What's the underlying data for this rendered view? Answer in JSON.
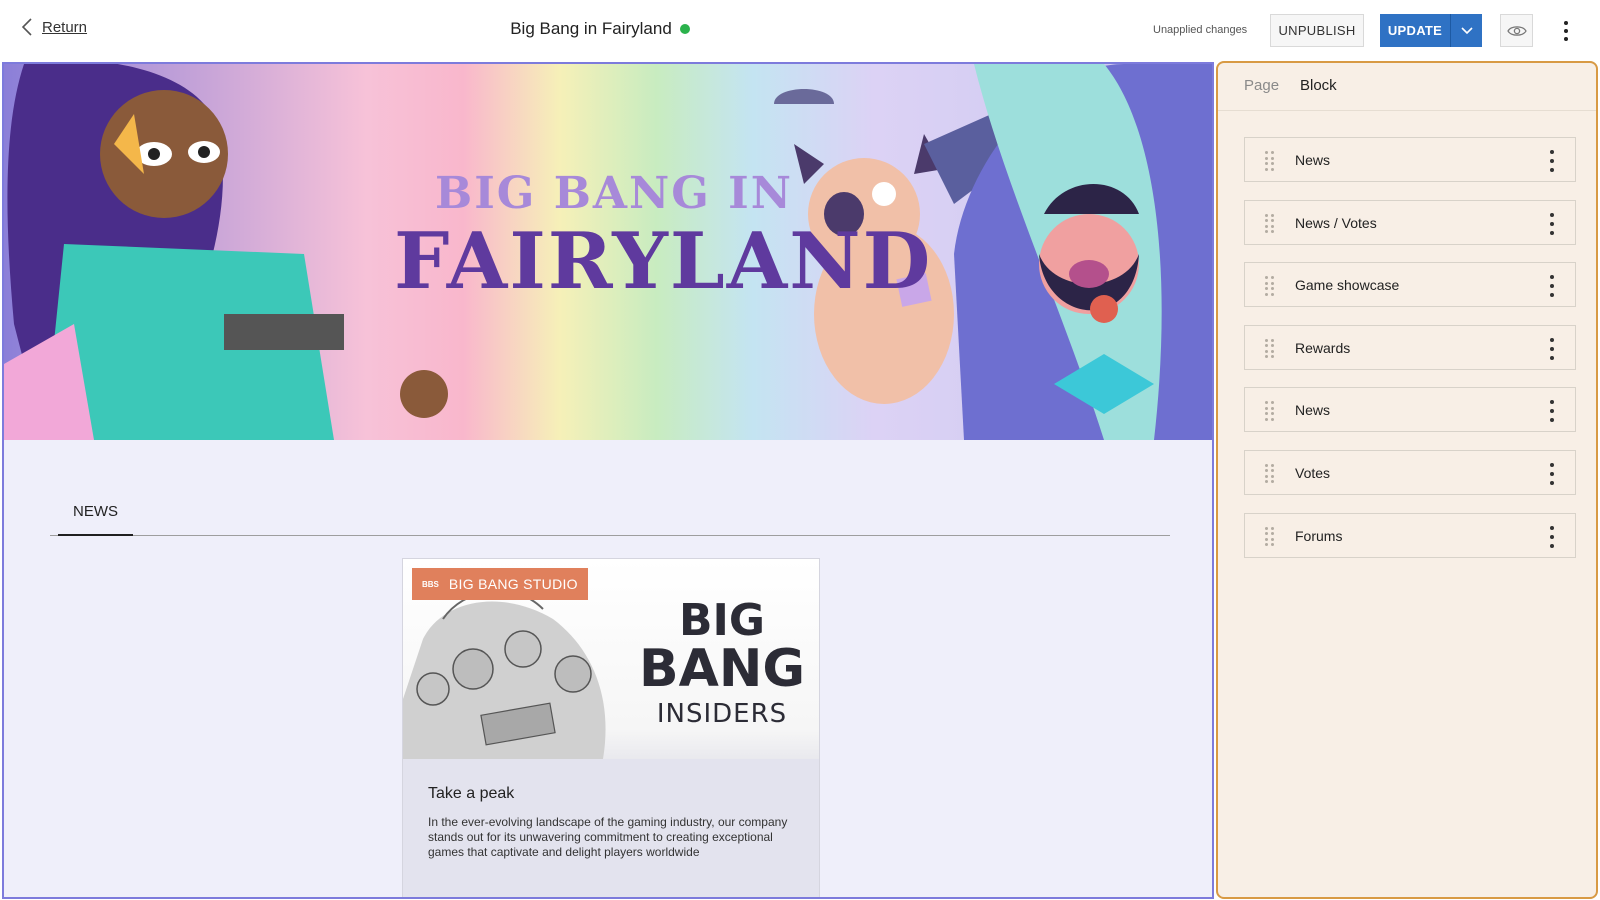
{
  "header": {
    "return_label": "Return",
    "page_title": "Big Bang in Fairyland",
    "status_color": "#2bb24c",
    "unapplied_text": "Unapplied changes",
    "unpublish_label": "UNPUBLISH",
    "update_label": "UPDATE"
  },
  "preview": {
    "hero": {
      "logo_line1": "BIG BANG IN",
      "logo_line2": "FAIRYLAND"
    },
    "tabs": [
      {
        "label": "NEWS"
      }
    ],
    "card": {
      "badge": "BIG BANG STUDIO",
      "badge_mini": "BBS",
      "image_text_line1": "BIG",
      "image_text_line2": "BANG",
      "image_text_line3": "INSIDERS",
      "title": "Take a peak",
      "description": "In the ever-evolving landscape of the gaming industry, our company stands out for its unwavering commitment to creating exceptional games that captivate and delight players worldwide"
    }
  },
  "panel": {
    "tabs": [
      "Page",
      "Block"
    ],
    "blocks": [
      {
        "label": "News"
      },
      {
        "label": "News / Votes"
      },
      {
        "label": "Game showcase"
      },
      {
        "label": "Rewards"
      },
      {
        "label": "News"
      },
      {
        "label": "Votes"
      },
      {
        "label": "Forums"
      }
    ]
  },
  "colors": {
    "accent": "#2f72c4",
    "preview_border": "#7d7bdc",
    "panel_border": "#d89a44",
    "badge": "#e0805c"
  }
}
